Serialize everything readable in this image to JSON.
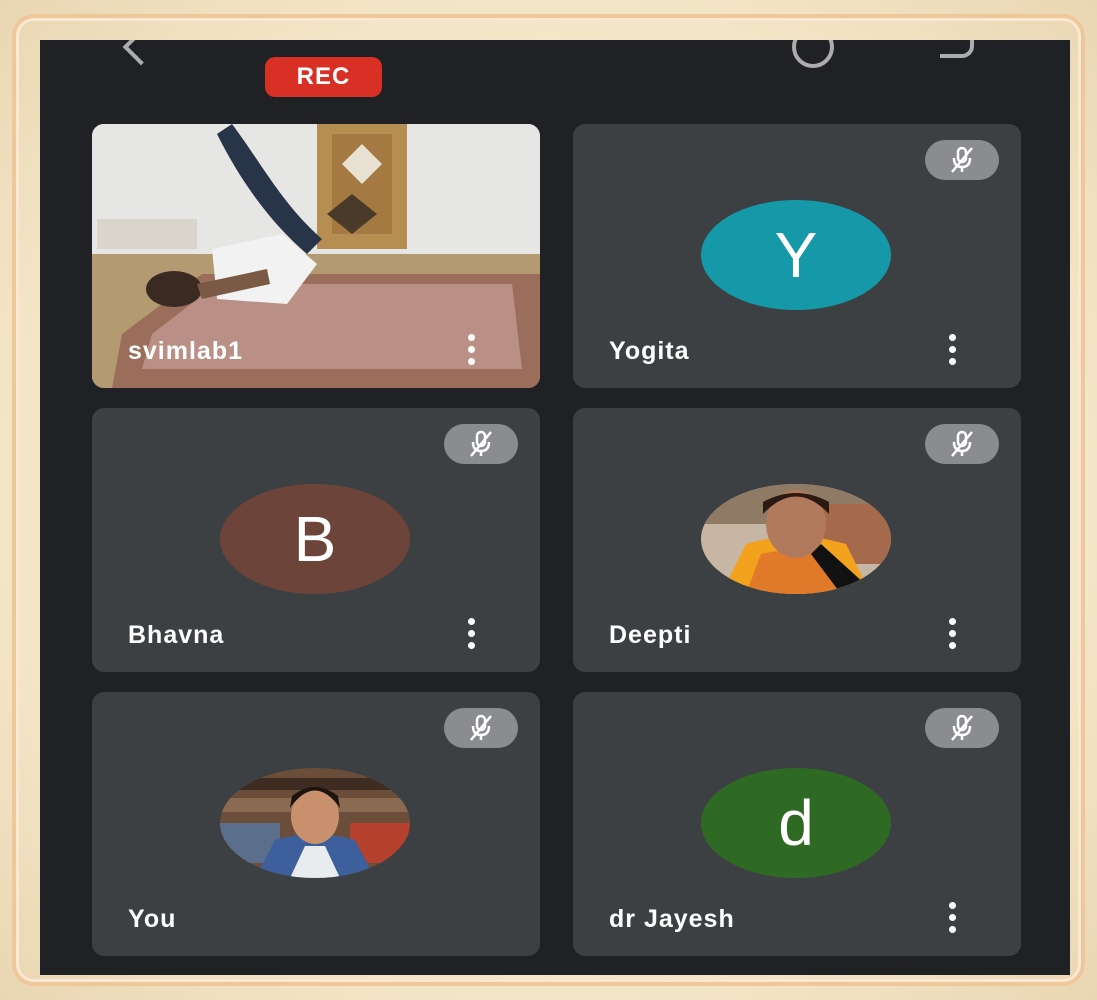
{
  "recording": {
    "label": "REC",
    "color": "#d93025"
  },
  "participants": [
    {
      "name": "svimlab1",
      "type": "video",
      "muted": false
    },
    {
      "name": "Yogita",
      "type": "initial",
      "initial": "Y",
      "avatar_color": "#1598a8",
      "muted": true
    },
    {
      "name": "Bhavna",
      "type": "initial",
      "initial": "B",
      "avatar_color": "#6d4439",
      "muted": true
    },
    {
      "name": "Deepti",
      "type": "photo",
      "muted": true
    },
    {
      "name": "You",
      "type": "photo",
      "muted": true
    },
    {
      "name": "dr Jayesh",
      "type": "initial",
      "initial": "d",
      "avatar_color": "#2f6a25",
      "muted": true
    }
  ],
  "icons": {
    "mute": "mic-off-icon",
    "more": "more-vert-icon",
    "back": "back-icon",
    "camera": "camera-switch-icon",
    "speaker": "speaker-icon"
  }
}
